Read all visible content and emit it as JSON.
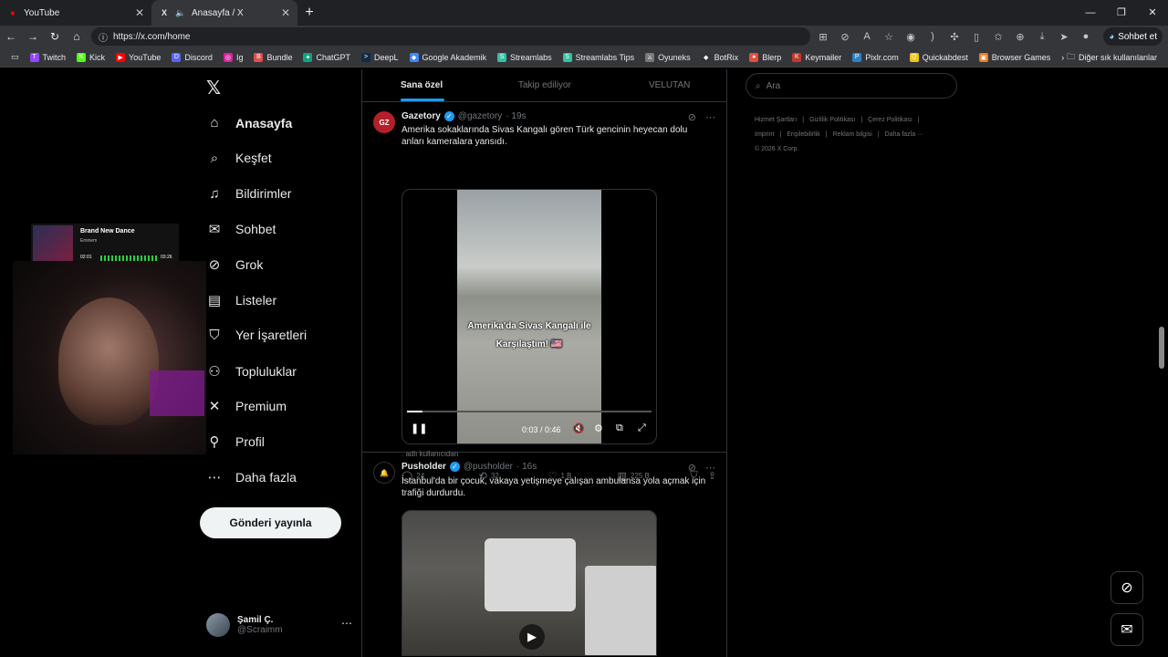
{
  "browser": {
    "tabs": [
      {
        "title": "YouTube"
      },
      {
        "title": "Anasayfa / X"
      }
    ],
    "url": "https://x.com/home",
    "sohbet_label": "Sohbet et",
    "bookmarks": [
      {
        "label": "Twitch",
        "color": "#9146ff",
        "glyph": "T"
      },
      {
        "label": "Kick",
        "color": "#53fc18",
        "glyph": "K"
      },
      {
        "label": "YouTube",
        "color": "#ff0000",
        "glyph": "▶"
      },
      {
        "label": "Discord",
        "color": "#5865f2",
        "glyph": "D"
      },
      {
        "label": "Ig",
        "color": "#d6249f",
        "glyph": "◎"
      },
      {
        "label": "Bundle",
        "color": "#e34b4b",
        "glyph": "B"
      },
      {
        "label": "ChatGPT",
        "color": "#10a37f",
        "glyph": "✦"
      },
      {
        "label": "DeepL",
        "color": "#0f2b46",
        "glyph": ">"
      },
      {
        "label": "Google Akademik",
        "color": "#4285f4",
        "glyph": "◆"
      },
      {
        "label": "Streamlabs",
        "color": "#31c3a2",
        "glyph": "S"
      },
      {
        "label": "Streamlabs Tips",
        "color": "#31c3a2",
        "glyph": "S"
      },
      {
        "label": "Oyuneks",
        "color": "#777777",
        "glyph": "⚔"
      },
      {
        "label": "BotRix",
        "color": "#333333",
        "glyph": "◆"
      },
      {
        "label": "Blerp",
        "color": "#e74c3c",
        "glyph": "●"
      },
      {
        "label": "Keymailer",
        "color": "#c0392b",
        "glyph": "K"
      },
      {
        "label": "Pixlr.com",
        "color": "#2c82c9",
        "glyph": "P"
      },
      {
        "label": "Quickabdest",
        "color": "#f1c40f",
        "glyph": "Q"
      },
      {
        "label": "Browser Games",
        "color": "#e67e22",
        "glyph": "▣"
      }
    ],
    "bookmarks_more": "Diğer sık kullanılanlar"
  },
  "x": {
    "nav": [
      {
        "label": "Anasayfa",
        "icon": "home-icon",
        "glyph": "⌂"
      },
      {
        "label": "Keşfet",
        "icon": "search-icon",
        "glyph": "⌕"
      },
      {
        "label": "Bildirimler",
        "icon": "bell-icon",
        "glyph": "♫"
      },
      {
        "label": "Sohbet",
        "icon": "mail-icon",
        "glyph": "✉"
      },
      {
        "label": "Grok",
        "icon": "grok-icon",
        "glyph": "⊘"
      },
      {
        "label": "Listeler",
        "icon": "list-icon",
        "glyph": "▤"
      },
      {
        "label": "Yer İşaretleri",
        "icon": "bookmark-icon",
        "glyph": "⛉"
      },
      {
        "label": "Topluluklar",
        "icon": "communities-icon",
        "glyph": "⚇"
      },
      {
        "label": "Premium",
        "icon": "x-logo-icon",
        "glyph": "✕"
      },
      {
        "label": "Profil",
        "icon": "profile-icon",
        "glyph": "⚲"
      },
      {
        "label": "Daha fazla",
        "icon": "more-circle-icon",
        "glyph": "⋯"
      }
    ],
    "post_button": "Gönderi yayınla",
    "profile": {
      "name": "Şamil Ç.",
      "handle": "@Scraimm"
    },
    "feed_tabs": [
      "Sana özel",
      "Takip ediliyor",
      "VELUTAN"
    ],
    "tweets": [
      {
        "name": "Gazetory",
        "handle": "@gazetory",
        "time": "· 19s",
        "text": "Amerika sokaklarında Sivas Kangalı gören Türk gencinin heyecan dolu anları kameralara yansıdı.",
        "video_caption": "Amerika'da Sivas Kangalı ile Karşılaştım! 🇺🇸",
        "video_time": "0:03 / 0:46",
        "video_progress": 0.065,
        "sub": ". adlı kullanıcıdan",
        "replies": "24",
        "reposts": "32",
        "likes": "1 B",
        "views": "225 B"
      },
      {
        "name": "Pusholder",
        "handle": "@pusholder",
        "time": "· 16s",
        "text": "İstanbul'da bir çocuk, vakaya yetişmeye çalışan ambulansa yola açmak için trafiği durdurdu."
      }
    ],
    "search_placeholder": "Ara",
    "footer_links": [
      "Hizmet Şartları",
      "|",
      "Gizlilik Politikası",
      "|",
      "Çerez Politikası",
      "|",
      "Imprint",
      "|",
      "Erişilebilirlik",
      "|",
      "Reklam bilgisi",
      "|",
      "Daha fazla ···",
      "© 2026 X Corp."
    ]
  },
  "now_playing": {
    "title": "Brand New Dance",
    "artist": "Eminem",
    "elapsed": "02:01",
    "duration": "03:26"
  }
}
